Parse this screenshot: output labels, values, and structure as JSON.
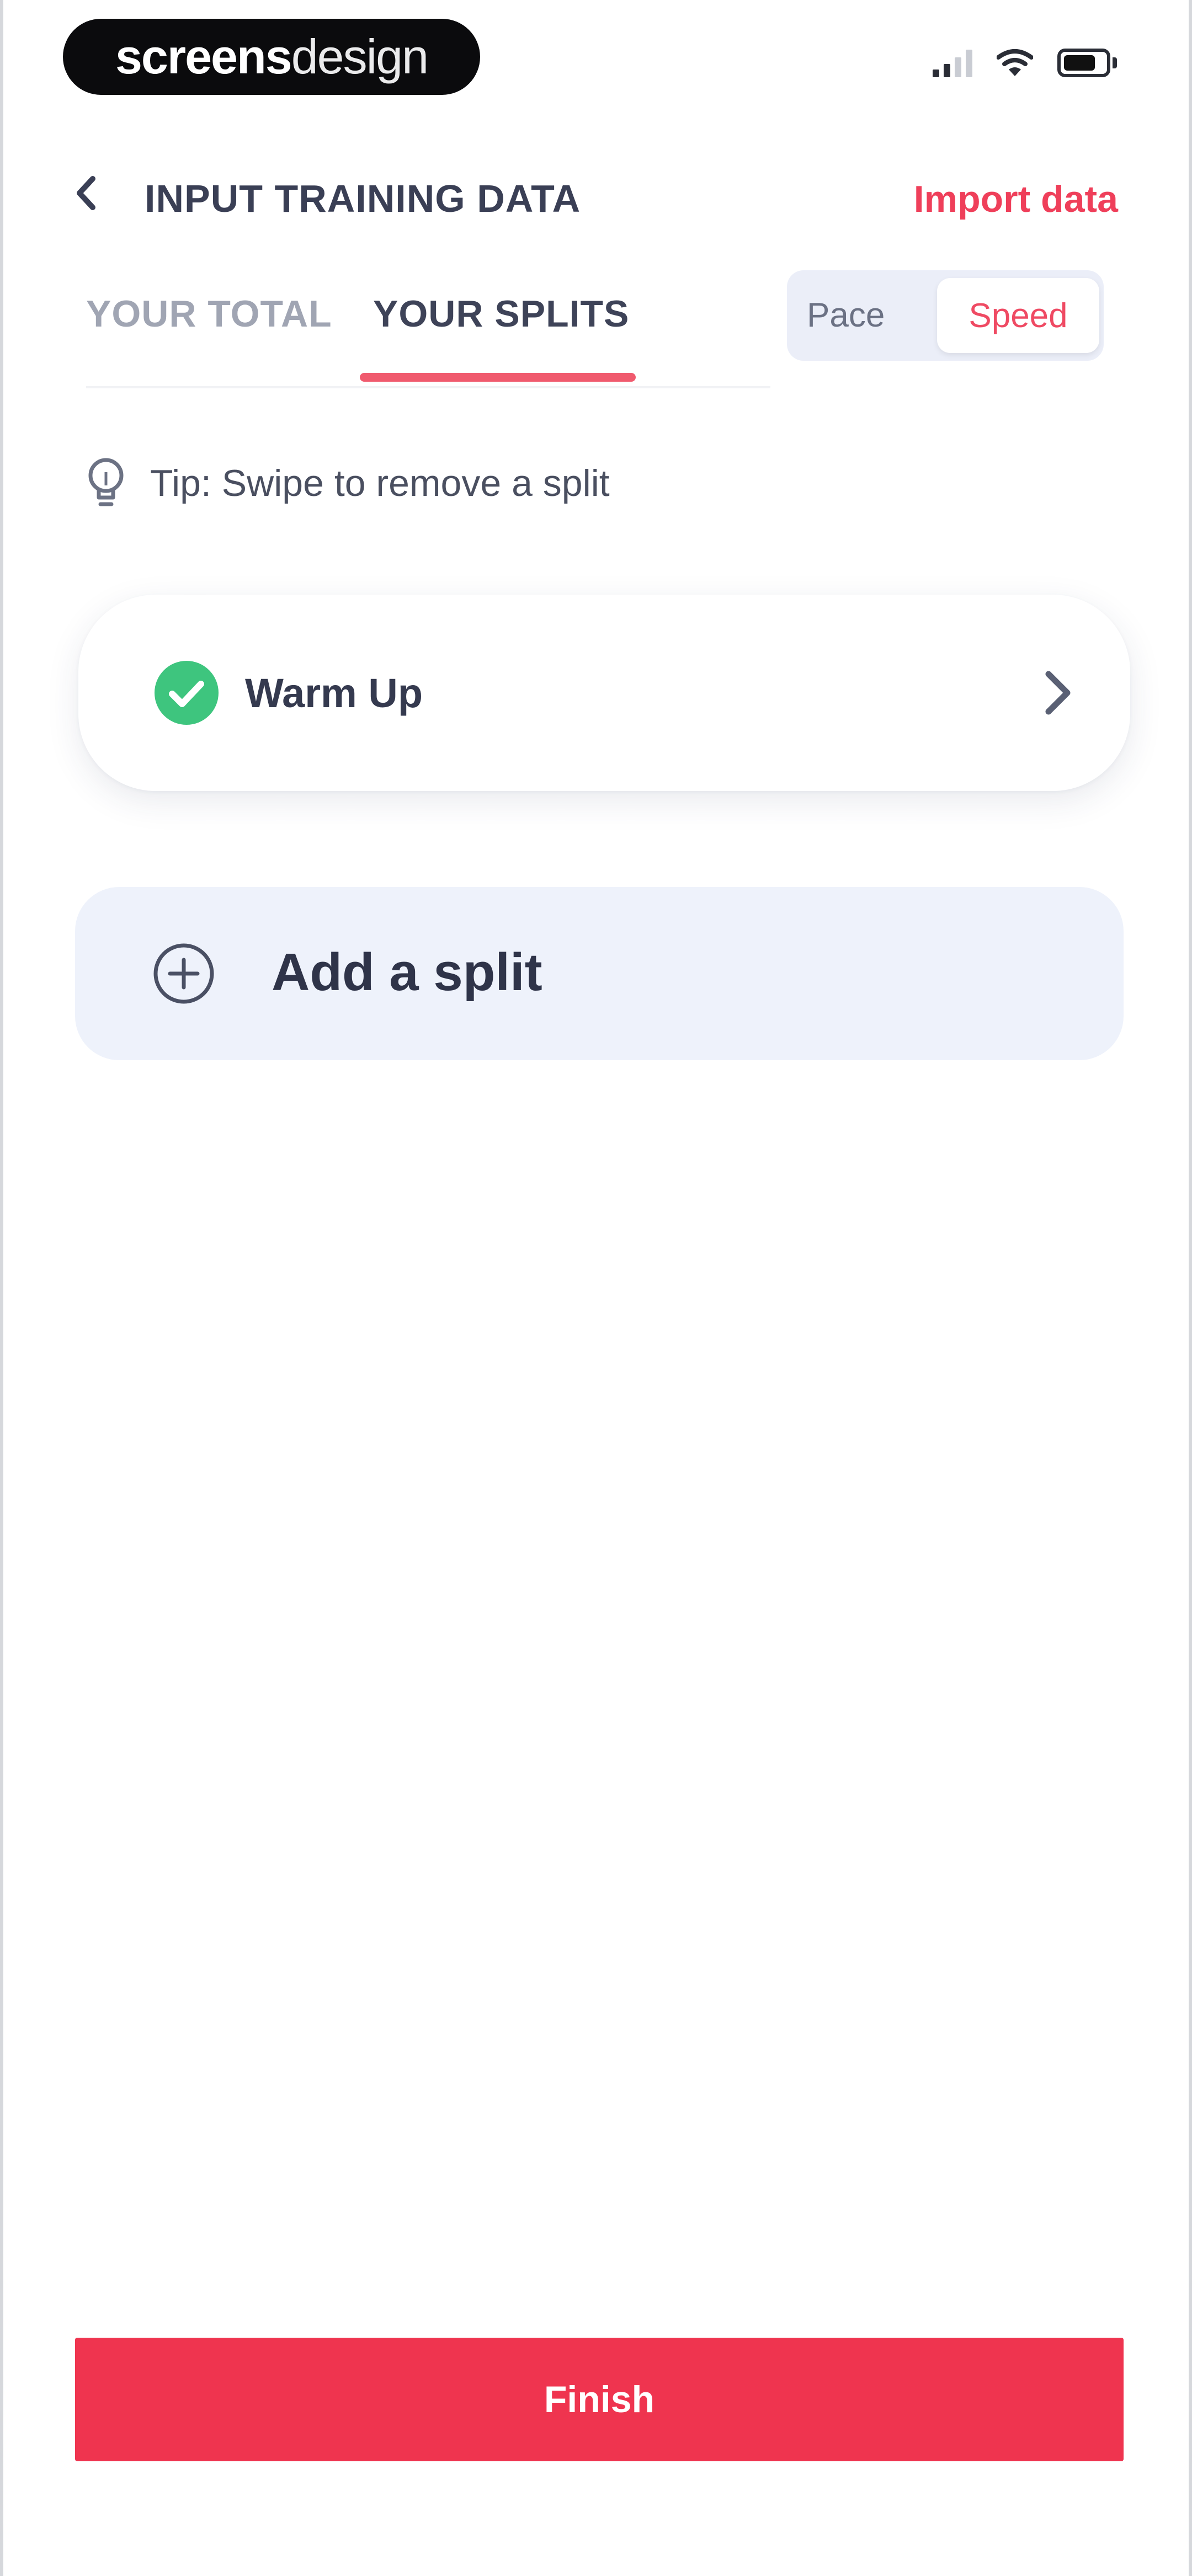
{
  "watermark": {
    "bold": "screens",
    "light": "design"
  },
  "header": {
    "back_icon": "chevron-left-icon",
    "title": "INPUT TRAINING DATA",
    "import_label": "Import data"
  },
  "tabs": {
    "items": [
      {
        "label": "YOUR TOTAL",
        "active": false
      },
      {
        "label": "YOUR SPLITS",
        "active": true
      }
    ]
  },
  "mode_toggle": {
    "options": [
      "Pace",
      "Speed"
    ],
    "selected": "Speed"
  },
  "tip": {
    "icon": "lightbulb-icon",
    "text": "Tip: Swipe to remove a split"
  },
  "splits": [
    {
      "label": "Warm Up",
      "status_icon": "check-circle-icon"
    }
  ],
  "add_split": {
    "icon": "plus-circle-icon",
    "label": "Add a split"
  },
  "footer": {
    "finish_label": "Finish"
  },
  "colors": {
    "accent": "#ef344f",
    "tab_underline": "#f05a6e",
    "check": "#3ec57e",
    "add_bg": "#eef2fb"
  }
}
